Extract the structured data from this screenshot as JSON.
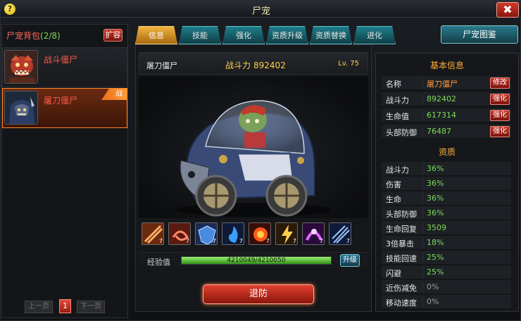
{
  "window": {
    "title": "尸宠",
    "help_label": "?",
    "close_label": "✖"
  },
  "left_panel": {
    "bag_title": "尸宠背包",
    "bag_count": "(2/8)",
    "expand_label": "扩容",
    "zombies": [
      {
        "name": "战斗僵尸",
        "selected": false,
        "tag": ""
      },
      {
        "name": "屠刀僵尸",
        "selected": true,
        "tag": "战"
      }
    ],
    "pager": {
      "prev_label": "上一页",
      "page": "1",
      "next_label": "下一页"
    }
  },
  "tabs": [
    {
      "label": "信息",
      "active": true
    },
    {
      "label": "技能",
      "active": false
    },
    {
      "label": "强化",
      "active": false
    },
    {
      "label": "资质升级",
      "active": false
    },
    {
      "label": "资质替换",
      "active": false
    },
    {
      "label": "进化",
      "active": false
    }
  ],
  "atlas_label": "尸宠图鉴",
  "center": {
    "zombie_name": "屠刀僵尸",
    "power_label": "战斗力",
    "power_value": "892402",
    "level": "Lv. 75",
    "skills": [
      {
        "icon": "blade-slash-icon",
        "level": "7"
      },
      {
        "icon": "whirl-cut-icon",
        "level": "7"
      },
      {
        "icon": "ice-shield-icon",
        "level": "7"
      },
      {
        "icon": "blue-flame-icon",
        "level": "7"
      },
      {
        "icon": "fire-burst-icon",
        "level": "7"
      },
      {
        "icon": "lightning-strike-icon",
        "level": "7"
      },
      {
        "icon": "purple-spirit-icon",
        "level": "7"
      },
      {
        "icon": "frost-claw-icon",
        "level": "7"
      }
    ],
    "exp_label": "经验值",
    "exp_text": "4210049/4210050",
    "exp_fraction": 0.9999,
    "upgrade_label": "升级",
    "retreat_label": "退防"
  },
  "right_panel": {
    "basic_title": "基本信息",
    "basic_rows": [
      {
        "key": "名称",
        "value": "屠刀僵尸",
        "button": "修改"
      },
      {
        "key": "战斗力",
        "value": "892402",
        "button": "强化"
      },
      {
        "key": "生命值",
        "value": "617314",
        "button": "强化"
      },
      {
        "key": "头部防御",
        "value": "76487",
        "button": "强化"
      }
    ],
    "aptitude_title": "资质",
    "aptitude_rows": [
      {
        "key": "战斗力",
        "value": "36%"
      },
      {
        "key": "伤害",
        "value": "36%"
      },
      {
        "key": "生命",
        "value": "36%"
      },
      {
        "key": "头部防御",
        "value": "36%"
      },
      {
        "key": "生命回复",
        "value": "3509"
      },
      {
        "key": "3倍暴击",
        "value": "18%"
      },
      {
        "key": "技能回速",
        "value": "25%"
      },
      {
        "key": "闪避",
        "value": "25%"
      },
      {
        "key": "近伤减免",
        "value": "0%"
      },
      {
        "key": "移动速度",
        "value": "0%"
      }
    ]
  },
  "colors": {
    "accent_orange": "#ffb03a",
    "value_green": "#7ddc5a",
    "button_red": "#c9352a",
    "tab_teal": "#1f7d8a"
  }
}
